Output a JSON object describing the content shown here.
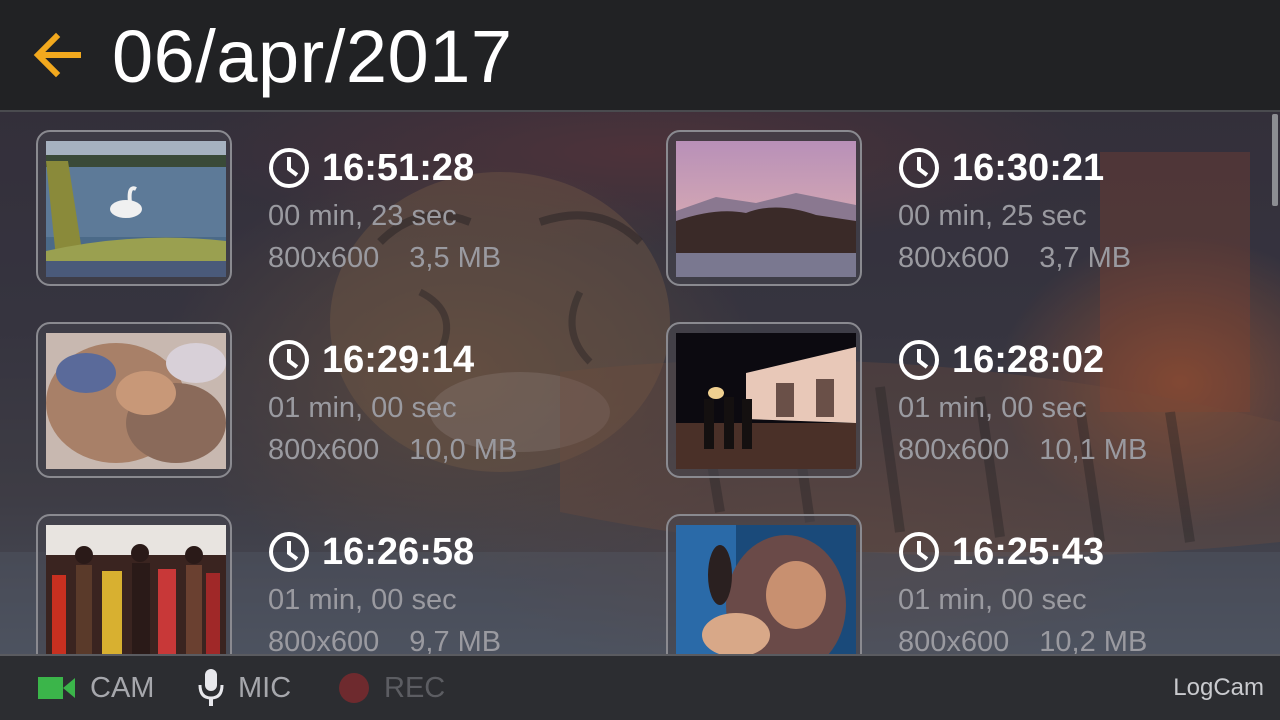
{
  "header": {
    "title": "06/apr/2017",
    "back_icon": "arrow-left-icon",
    "accent_color": "#f2a91e"
  },
  "recordings": [
    {
      "time": "16:51:28",
      "duration": "00 min, 23 sec",
      "resolution": "800x600",
      "size": "3,5 MB"
    },
    {
      "time": "16:30:21",
      "duration": "00 min, 25 sec",
      "resolution": "800x600",
      "size": "3,7 MB"
    },
    {
      "time": "16:29:14",
      "duration": "01 min, 00 sec",
      "resolution": "800x600",
      "size": "10,0 MB"
    },
    {
      "time": "16:28:02",
      "duration": "01 min, 00 sec",
      "resolution": "800x600",
      "size": "10,1 MB"
    },
    {
      "time": "16:26:58",
      "duration": "01 min, 00 sec",
      "resolution": "800x600",
      "size": "9,7 MB"
    },
    {
      "time": "16:25:43",
      "duration": "01 min, 00 sec",
      "resolution": "800x600",
      "size": "10,2 MB"
    }
  ],
  "bottom_bar": {
    "cam": {
      "label": "CAM",
      "icon": "video-camera-icon",
      "color": "#3bb54a"
    },
    "mic": {
      "label": "MIC",
      "icon": "microphone-icon"
    },
    "rec": {
      "label": "REC",
      "icon": "record-dot-icon",
      "color": "#6e2a2e"
    },
    "app_name": "LogCam"
  }
}
